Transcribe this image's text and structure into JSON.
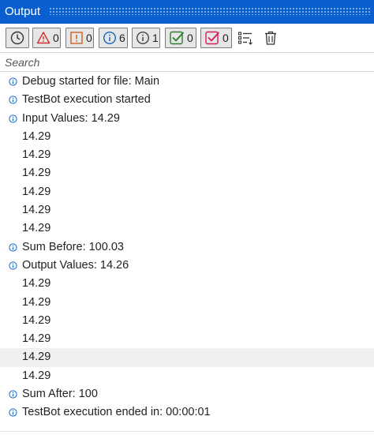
{
  "panel": {
    "title": "Output"
  },
  "toolbar": {
    "errors_count": "0",
    "warnings_count": "0",
    "info_count": "6",
    "trace_count": "1",
    "success_count": "0",
    "failed_count": "0"
  },
  "search": {
    "placeholder": "Search",
    "value": ""
  },
  "log": [
    {
      "type": "info",
      "text": "Debug started for file: Main"
    },
    {
      "type": "info",
      "text": "TestBot execution started"
    },
    {
      "type": "info",
      "text": "Input Values: 14.29"
    },
    {
      "type": "plain",
      "text": "14.29"
    },
    {
      "type": "plain",
      "text": "14.29"
    },
    {
      "type": "plain",
      "text": "14.29"
    },
    {
      "type": "plain",
      "text": "14.29"
    },
    {
      "type": "plain",
      "text": "14.29"
    },
    {
      "type": "plain",
      "text": "14.29"
    },
    {
      "type": "info",
      "text": "Sum Before: 100.03"
    },
    {
      "type": "info",
      "text": "Output Values: 14.26"
    },
    {
      "type": "plain",
      "text": "14.29"
    },
    {
      "type": "plain",
      "text": "14.29"
    },
    {
      "type": "plain",
      "text": "14.29"
    },
    {
      "type": "plain",
      "text": "14.29"
    },
    {
      "type": "plain",
      "text": "14.29",
      "selected": true
    },
    {
      "type": "plain",
      "text": "14.29"
    },
    {
      "type": "info",
      "text": "Sum After: 100"
    },
    {
      "type": "info",
      "text": "TestBot execution ended in: 00:00:01"
    }
  ],
  "colors": {
    "titlebar": "#0a5fd0",
    "error": "#d32f2f",
    "warning": "#c8641e",
    "info": "#1565c0",
    "success": "#2e7d32",
    "failed": "#d81b60"
  },
  "icons": [
    "clock-icon",
    "error-triangle-icon",
    "warning-icon",
    "info-icon",
    "trace-icon",
    "success-check-icon",
    "failed-check-icon",
    "clear-filters-icon",
    "trash-icon"
  ]
}
